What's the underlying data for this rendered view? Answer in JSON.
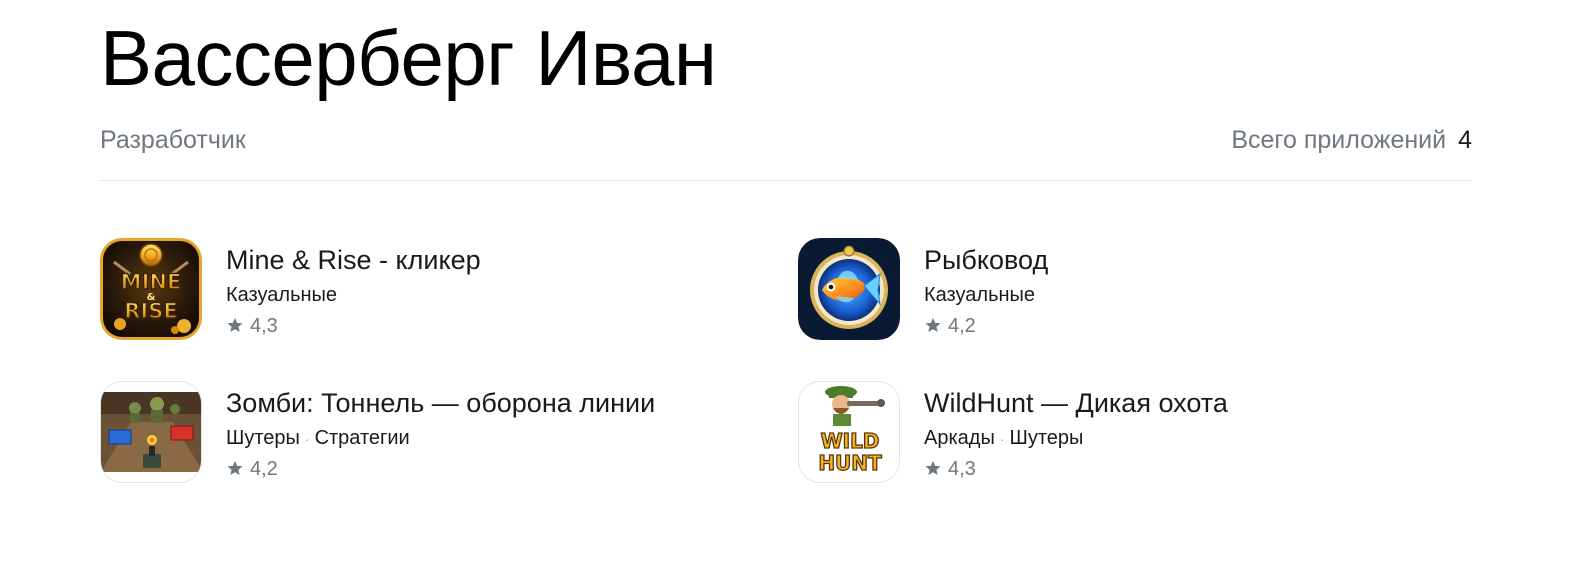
{
  "developer": {
    "name": "Вассерберг Иван",
    "role": "Разработчик",
    "total_label": "Всего приложений",
    "total_count": "4"
  },
  "apps": [
    {
      "title": "Mine & Rise - кликер",
      "tags": [
        "Казуальные"
      ],
      "rating": "4,3",
      "icon": "mine-rise-icon",
      "icon_text": [
        "MINE",
        "&",
        "RISE"
      ]
    },
    {
      "title": "Рыбковод",
      "tags": [
        "Казуальные"
      ],
      "rating": "4,2",
      "icon": "fish-icon"
    },
    {
      "title": "Зомби: Тоннель — оборона линии",
      "tags": [
        "Шутеры",
        "Стратегии"
      ],
      "rating": "4,2",
      "icon": "zombie-tunnel-icon"
    },
    {
      "title": "WildHunt — Дикая охота",
      "tags": [
        "Аркады",
        "Шутеры"
      ],
      "rating": "4,3",
      "icon": "wildhunt-icon",
      "icon_text": [
        "WILD",
        "HUNT"
      ]
    }
  ],
  "colors": {
    "muted_text": "#6f7780",
    "star": "#6f7780",
    "divider": "#e4e4e4"
  }
}
